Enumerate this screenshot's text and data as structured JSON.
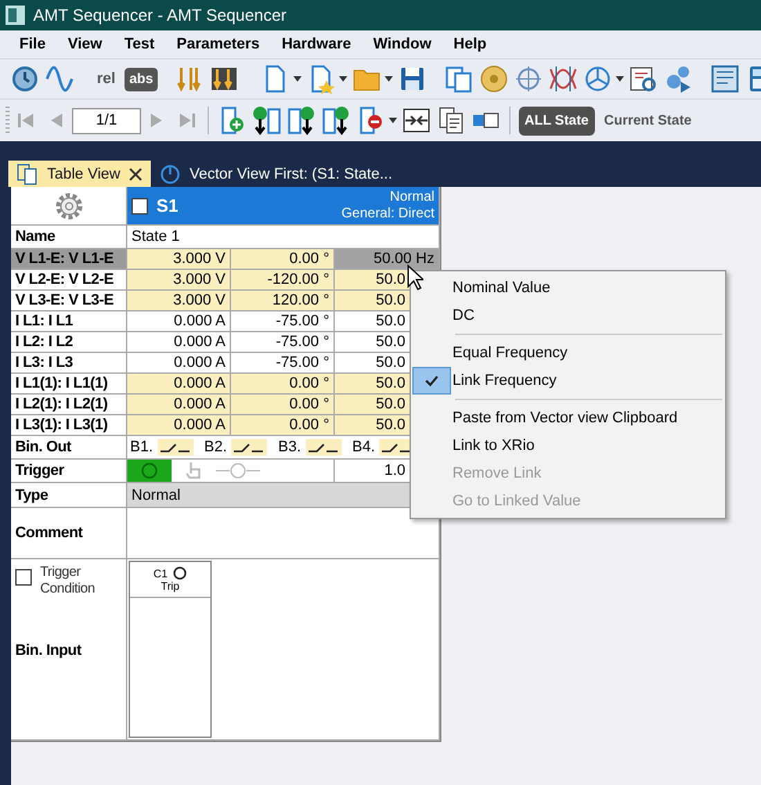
{
  "window": {
    "title": "AMT Sequencer - AMT Sequencer"
  },
  "menu": [
    "File",
    "View",
    "Test",
    "Parameters",
    "Hardware",
    "Window",
    "Help"
  ],
  "toolbar": {
    "rel_label": "rel",
    "abs_label": "abs",
    "page_field": {
      "value": "1/1"
    },
    "state_buttons": [
      {
        "label": "ALL State",
        "selected": true
      },
      {
        "label": "Current State",
        "selected": false
      }
    ]
  },
  "tabs": [
    {
      "label": "Table View",
      "selected": true
    },
    {
      "label": "Vector View First: (S1: State...",
      "selected": false
    }
  ],
  "state": {
    "id": "S1",
    "checked": false,
    "mode": "Normal",
    "mode_detail": "General: Direct",
    "name_label": "Name",
    "name": "State 1"
  },
  "rows": [
    {
      "label": "V L1-E: V L1-E",
      "values": [
        "3.000 V",
        "0.00 °",
        "50.00 Hz"
      ],
      "shaded": true,
      "selected": true
    },
    {
      "label": "V L2-E: V L2-E",
      "values": [
        "3.000 V",
        "-120.00 °",
        "50.0"
      ],
      "shaded": true,
      "selected": false
    },
    {
      "label": "V L3-E: V L3-E",
      "values": [
        "3.000 V",
        "120.00 °",
        "50.0"
      ],
      "shaded": true,
      "selected": false
    },
    {
      "label": "I L1: I L1",
      "values": [
        "0.000 A",
        "-75.00 °",
        "50.0"
      ],
      "shaded": false,
      "selected": false
    },
    {
      "label": "I L2: I L2",
      "values": [
        "0.000 A",
        "-75.00 °",
        "50.0"
      ],
      "shaded": false,
      "selected": false
    },
    {
      "label": "I L3: I L3",
      "values": [
        "0.000 A",
        "-75.00 °",
        "50.0"
      ],
      "shaded": false,
      "selected": false
    },
    {
      "label": "I L1(1): I L1(1)",
      "values": [
        "0.000 A",
        "0.00 °",
        "50.0"
      ],
      "shaded": true,
      "selected": false
    },
    {
      "label": "I L2(1): I L2(1)",
      "values": [
        "0.000 A",
        "0.00 °",
        "50.0"
      ],
      "shaded": true,
      "selected": false
    },
    {
      "label": "I L3(1): I L3(1)",
      "values": [
        "0.000 A",
        "0.00 °",
        "50.0"
      ],
      "shaded": true,
      "selected": false
    }
  ],
  "bin_out": {
    "label": "Bin. Out",
    "outputs": [
      "B1.",
      "B2.",
      "B3.",
      "B4."
    ]
  },
  "trigger": {
    "label": "Trigger",
    "value": "1.0"
  },
  "type": {
    "label": "Type",
    "value": "Normal"
  },
  "comment": {
    "label": "Comment"
  },
  "trigger_condition": {
    "label": "Trigger Condition",
    "checked": false
  },
  "bin_input": {
    "label": "Bin. Input",
    "channels": [
      {
        "id": "C1",
        "name": "Trip"
      }
    ]
  },
  "context_menu": [
    {
      "kind": "item",
      "label": "Nominal Value",
      "checked": false,
      "disabled": false
    },
    {
      "kind": "item",
      "label": "DC",
      "checked": false,
      "disabled": false
    },
    {
      "kind": "separator"
    },
    {
      "kind": "item",
      "label": "Equal Frequency",
      "checked": false,
      "disabled": false
    },
    {
      "kind": "item",
      "label": "Link Frequency",
      "checked": true,
      "disabled": false
    },
    {
      "kind": "separator"
    },
    {
      "kind": "item",
      "label": "Paste from Vector view Clipboard",
      "checked": false,
      "disabled": false
    },
    {
      "kind": "item",
      "label": "Link to XRio",
      "checked": false,
      "disabled": false
    },
    {
      "kind": "item",
      "label": "Remove Link",
      "checked": false,
      "disabled": true
    },
    {
      "kind": "item",
      "label": "Go to Linked Value",
      "checked": false,
      "disabled": true
    }
  ]
}
